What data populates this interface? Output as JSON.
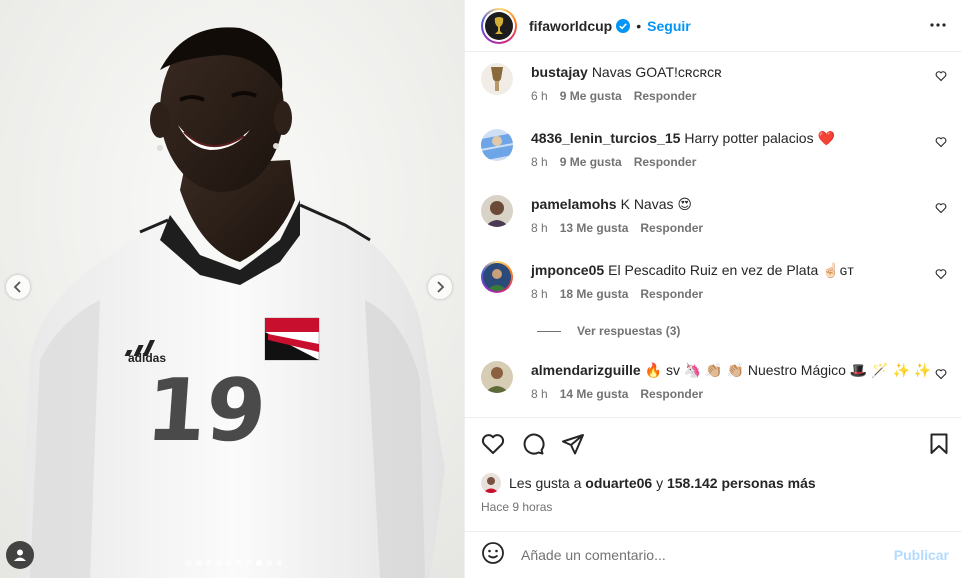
{
  "header": {
    "username": "fifaworldcup",
    "separator": "•",
    "follow_label": "Seguir"
  },
  "comments": [
    {
      "user": "bustajay",
      "text": "Navas GOAT!ᴄʀᴄʀᴄʀ",
      "time": "6 h",
      "likes": "9 Me gusta",
      "reply": "Responder"
    },
    {
      "user": "4836_lenin_turcios_15",
      "text": "Harry potter palacios ❤️",
      "time": "8 h",
      "likes": "9 Me gusta",
      "reply": "Responder"
    },
    {
      "user": "pamelamohs",
      "text": "K Navas 😍",
      "time": "8 h",
      "likes": "13 Me gusta",
      "reply": "Responder"
    },
    {
      "user": "jmponce05",
      "text": "El Pescadito Ruiz en vez de Plata ☝🏻ɢᴛ",
      "time": "8 h",
      "likes": "18 Me gusta",
      "reply": "Responder"
    },
    {
      "user": "almendarizguille",
      "text": "🔥 sv 🦄 👏🏼 👏🏼 Nuestro Mágico 🎩 🪄 ✨ ✨",
      "time": "8 h",
      "likes": "14 Me gusta",
      "reply": "Responder"
    }
  ],
  "view_replies": "Ver respuestas (3)",
  "likes_summary": {
    "prefix": "Les gusta a",
    "user": "oduarte06",
    "middle": "y",
    "count": "158.142 personas más"
  },
  "posted_ago": "Hace 9 horas",
  "composer": {
    "placeholder": "Añade un comentario...",
    "publish_label": "Publicar"
  },
  "photo": {
    "jersey_number": "19",
    "jersey_brand": "adidas",
    "carousel_slides": 10,
    "active_slide": 7
  },
  "colors": {
    "link_blue": "#0095f6",
    "publish_disabled": "#b3dbff",
    "heart_red": "#ed4956"
  },
  "icons": [
    "chevron-left-icon",
    "chevron-right-icon",
    "verified-badge-icon",
    "more-icon",
    "heart-icon",
    "comment-icon",
    "share-icon",
    "bookmark-icon",
    "emoji-icon",
    "tag-user-icon"
  ]
}
